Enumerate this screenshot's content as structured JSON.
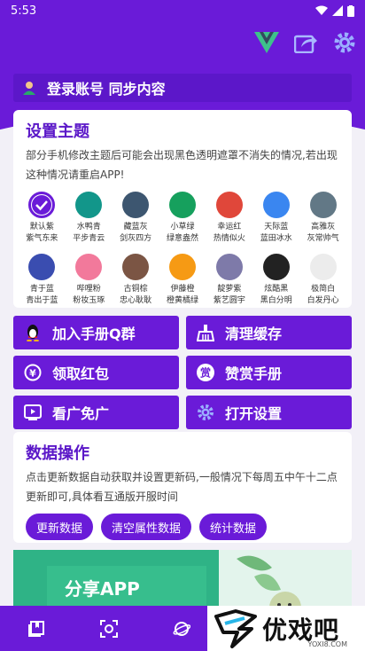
{
  "status_bar": {
    "time": "5:53"
  },
  "login": {
    "label": "登录账号 同步内容"
  },
  "theme": {
    "title": "设置主题",
    "desc": "部分手机修改主题后可能会出现黑色透明遮罩不消失的情况,若出现这种情况请重启APP!",
    "swatches": [
      {
        "name": "默认紫",
        "sub": "紫气东来",
        "color": "#6a1bd8",
        "selected": true
      },
      {
        "name": "水鸭青",
        "sub": "平步青云",
        "color": "#12968a"
      },
      {
        "name": "藏蓝灰",
        "sub": "剑灰四方",
        "color": "#3d5670"
      },
      {
        "name": "小草绿",
        "sub": "绿意盎然",
        "color": "#16a05d"
      },
      {
        "name": "幸运红",
        "sub": "热情似火",
        "color": "#e0473a"
      },
      {
        "name": "天际蓝",
        "sub": "蓝田冰水",
        "color": "#3a86f0"
      },
      {
        "name": "高雅灰",
        "sub": "灰常帅气",
        "color": "#627886"
      },
      {
        "name": "青于蓝",
        "sub": "青出于蓝",
        "color": "#3a4db0"
      },
      {
        "name": "哔哩粉",
        "sub": "粉妆玉琢",
        "color": "#f2799b"
      },
      {
        "name": "古铜棕",
        "sub": "忠心耿耿",
        "color": "#7b5544"
      },
      {
        "name": "伊藤橙",
        "sub": "橙黄橘绿",
        "color": "#f69a14"
      },
      {
        "name": "靛萝紫",
        "sub": "紫艺圆宇",
        "color": "#7e7aa9"
      },
      {
        "name": "炫酷黑",
        "sub": "黑白分明",
        "color": "#222222"
      },
      {
        "name": "极简白",
        "sub": "白发丹心",
        "color": "#ececec"
      }
    ]
  },
  "actions": {
    "join_group": "加入手册Q群",
    "clear_cache": "清理缓存",
    "red_packet": "领取红包",
    "donate": "赞赏手册",
    "watch_ad": "看广免广",
    "open_settings": "打开设置"
  },
  "data_ops": {
    "title": "数据操作",
    "desc": "点击更新数据自动获取并设置更新码,一般情况下每周五中午十二点更新即可,具体看互通版开服时间",
    "buttons": [
      "更新数据",
      "清空属性数据",
      "统计数据"
    ]
  },
  "share": {
    "title": "分享APP"
  },
  "watermark": {
    "text": "优戏吧",
    "url": "YOXI8.COM"
  },
  "colors": {
    "accent": "#6a1bd8",
    "accent_dark": "#5c17c9"
  }
}
